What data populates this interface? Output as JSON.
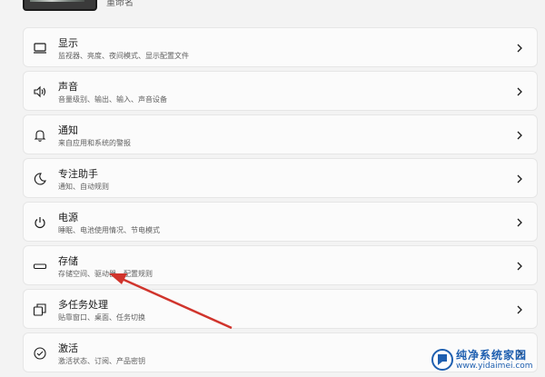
{
  "header": {
    "rename_label": "重命名"
  },
  "settings": [
    {
      "title": "显示",
      "subtitle": "监视器、亮度、夜间模式、显示配置文件",
      "icon": "monitor-icon"
    },
    {
      "title": "声音",
      "subtitle": "音量级别、输出、输入、声音设备",
      "icon": "speaker-icon"
    },
    {
      "title": "通知",
      "subtitle": "来自应用和系统的警报",
      "icon": "bell-icon"
    },
    {
      "title": "专注助手",
      "subtitle": "通知、自动规则",
      "icon": "moon-icon"
    },
    {
      "title": "电源",
      "subtitle": "睡眠、电池使用情况、节电模式",
      "icon": "power-icon"
    },
    {
      "title": "存储",
      "subtitle": "存储空间、驱动器、配置规则",
      "icon": "storage-drive-icon"
    },
    {
      "title": "多任务处理",
      "subtitle": "贴靠窗口、桌面、任务切换",
      "icon": "multitasking-icon"
    },
    {
      "title": "激活",
      "subtitle": "激活状态、订阅、产品密钥",
      "icon": "check-circle-icon"
    }
  ],
  "annotation": {
    "color": "#d0342c"
  },
  "watermark": {
    "name": "纯净系统家园",
    "url": "www.yidaimei.com",
    "color": "#1e5fb0"
  }
}
